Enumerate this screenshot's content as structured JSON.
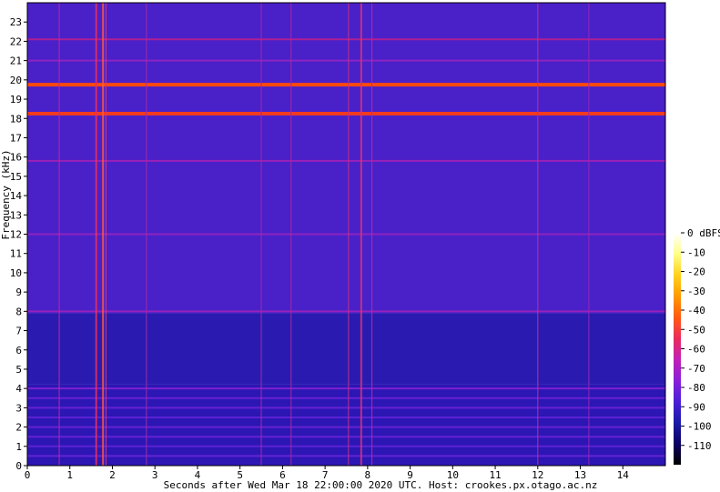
{
  "chart_data": {
    "type": "heatmap",
    "title": "",
    "xlabel": "Seconds after Wed Mar 18 22:00:00 2020 UTC. Host: crookes.px.otago.ac.nz",
    "ylabel": "Frequency (kHz)",
    "xlim": [
      0,
      15
    ],
    "ylim": [
      0,
      24
    ],
    "x_ticks": [
      "0",
      "1",
      "2",
      "3",
      "4",
      "5",
      "6",
      "7",
      "8",
      "9",
      "10",
      "11",
      "12",
      "13",
      "14"
    ],
    "y_ticks": [
      "0",
      "1",
      "2",
      "3",
      "4",
      "5",
      "6",
      "7",
      "8",
      "9",
      "10",
      "11",
      "12",
      "13",
      "14",
      "15",
      "16",
      "17",
      "18",
      "19",
      "20",
      "21",
      "22",
      "23"
    ],
    "colorbar": {
      "unit_label": "0 dBFS",
      "range_dbfs": [
        -120,
        0
      ],
      "ticks": [
        "-10",
        "-20",
        "-30",
        "-40",
        "-50",
        "-60",
        "-70",
        "-80",
        "-90",
        "-100",
        "-110"
      ],
      "colors": [
        "#000000",
        "#0b0063",
        "#1a1aa8",
        "#4a1fd8",
        "#8a1fd8",
        "#c21fb4",
        "#ec2a5a",
        "#ff5a10",
        "#ff9a00",
        "#ffd21e",
        "#ffff88",
        "#ffffff"
      ]
    },
    "background_levels": [
      {
        "from_khz": 0,
        "to_khz": 4.2,
        "dbfs": -102,
        "note_color": "#2c16b4"
      },
      {
        "from_khz": 4.2,
        "to_khz": 7.9,
        "dbfs": -100,
        "note_color": "#2a1ab0"
      },
      {
        "from_khz": 7.9,
        "to_khz": 24,
        "dbfs": -90,
        "note_color": "#4a20c8"
      }
    ],
    "horizontal_lines": [
      {
        "freq_khz": 19.75,
        "dbfs": -50,
        "color": "#ff4a0a"
      },
      {
        "freq_khz": 18.25,
        "dbfs": -55,
        "color": "#f23a1e"
      },
      {
        "freq_khz": 22.1,
        "dbfs": -72,
        "color": "#c0208c"
      },
      {
        "freq_khz": 21.0,
        "dbfs": -78,
        "color": "#9a24c0"
      },
      {
        "freq_khz": 15.8,
        "dbfs": -75,
        "color": "#a822b4"
      },
      {
        "freq_khz": 12.0,
        "dbfs": -78,
        "color": "#9a24c0"
      },
      {
        "freq_khz": 8.0,
        "dbfs": -75,
        "color": "#a522b8"
      },
      {
        "freq_khz": 4.0,
        "dbfs": -78,
        "color": "#8a24d0"
      },
      {
        "freq_khz": 3.5,
        "dbfs": -84,
        "color": "#7024d8"
      },
      {
        "freq_khz": 3.0,
        "dbfs": -84,
        "color": "#7024d8"
      },
      {
        "freq_khz": 2.5,
        "dbfs": -86,
        "color": "#6424d8"
      },
      {
        "freq_khz": 2.0,
        "dbfs": -84,
        "color": "#7024d8"
      },
      {
        "freq_khz": 1.5,
        "dbfs": -84,
        "color": "#7024d8"
      },
      {
        "freq_khz": 1.0,
        "dbfs": -86,
        "color": "#6424d8"
      },
      {
        "freq_khz": 0.5,
        "dbfs": -84,
        "color": "#7024d8"
      }
    ],
    "vertical_impulses": [
      {
        "time_s": 0.75,
        "dbfs": -78,
        "color": "#b02ab0"
      },
      {
        "time_s": 1.62,
        "dbfs": -70,
        "color": "#e8305a"
      },
      {
        "time_s": 1.78,
        "dbfs": -62,
        "color": "#ff5a3a"
      },
      {
        "time_s": 1.85,
        "dbfs": -72,
        "color": "#d03a80"
      },
      {
        "time_s": 2.8,
        "dbfs": -80,
        "color": "#a02aa8"
      },
      {
        "time_s": 5.5,
        "dbfs": -80,
        "color": "#a02aa8"
      },
      {
        "time_s": 6.2,
        "dbfs": -80,
        "color": "#a02aa8"
      },
      {
        "time_s": 7.55,
        "dbfs": -74,
        "color": "#c0308c"
      },
      {
        "time_s": 7.85,
        "dbfs": -70,
        "color": "#d83472"
      },
      {
        "time_s": 8.1,
        "dbfs": -76,
        "color": "#b82aa0"
      },
      {
        "time_s": 12.0,
        "dbfs": -74,
        "color": "#c0308c"
      },
      {
        "time_s": 13.2,
        "dbfs": -82,
        "color": "#9028b8"
      }
    ]
  }
}
